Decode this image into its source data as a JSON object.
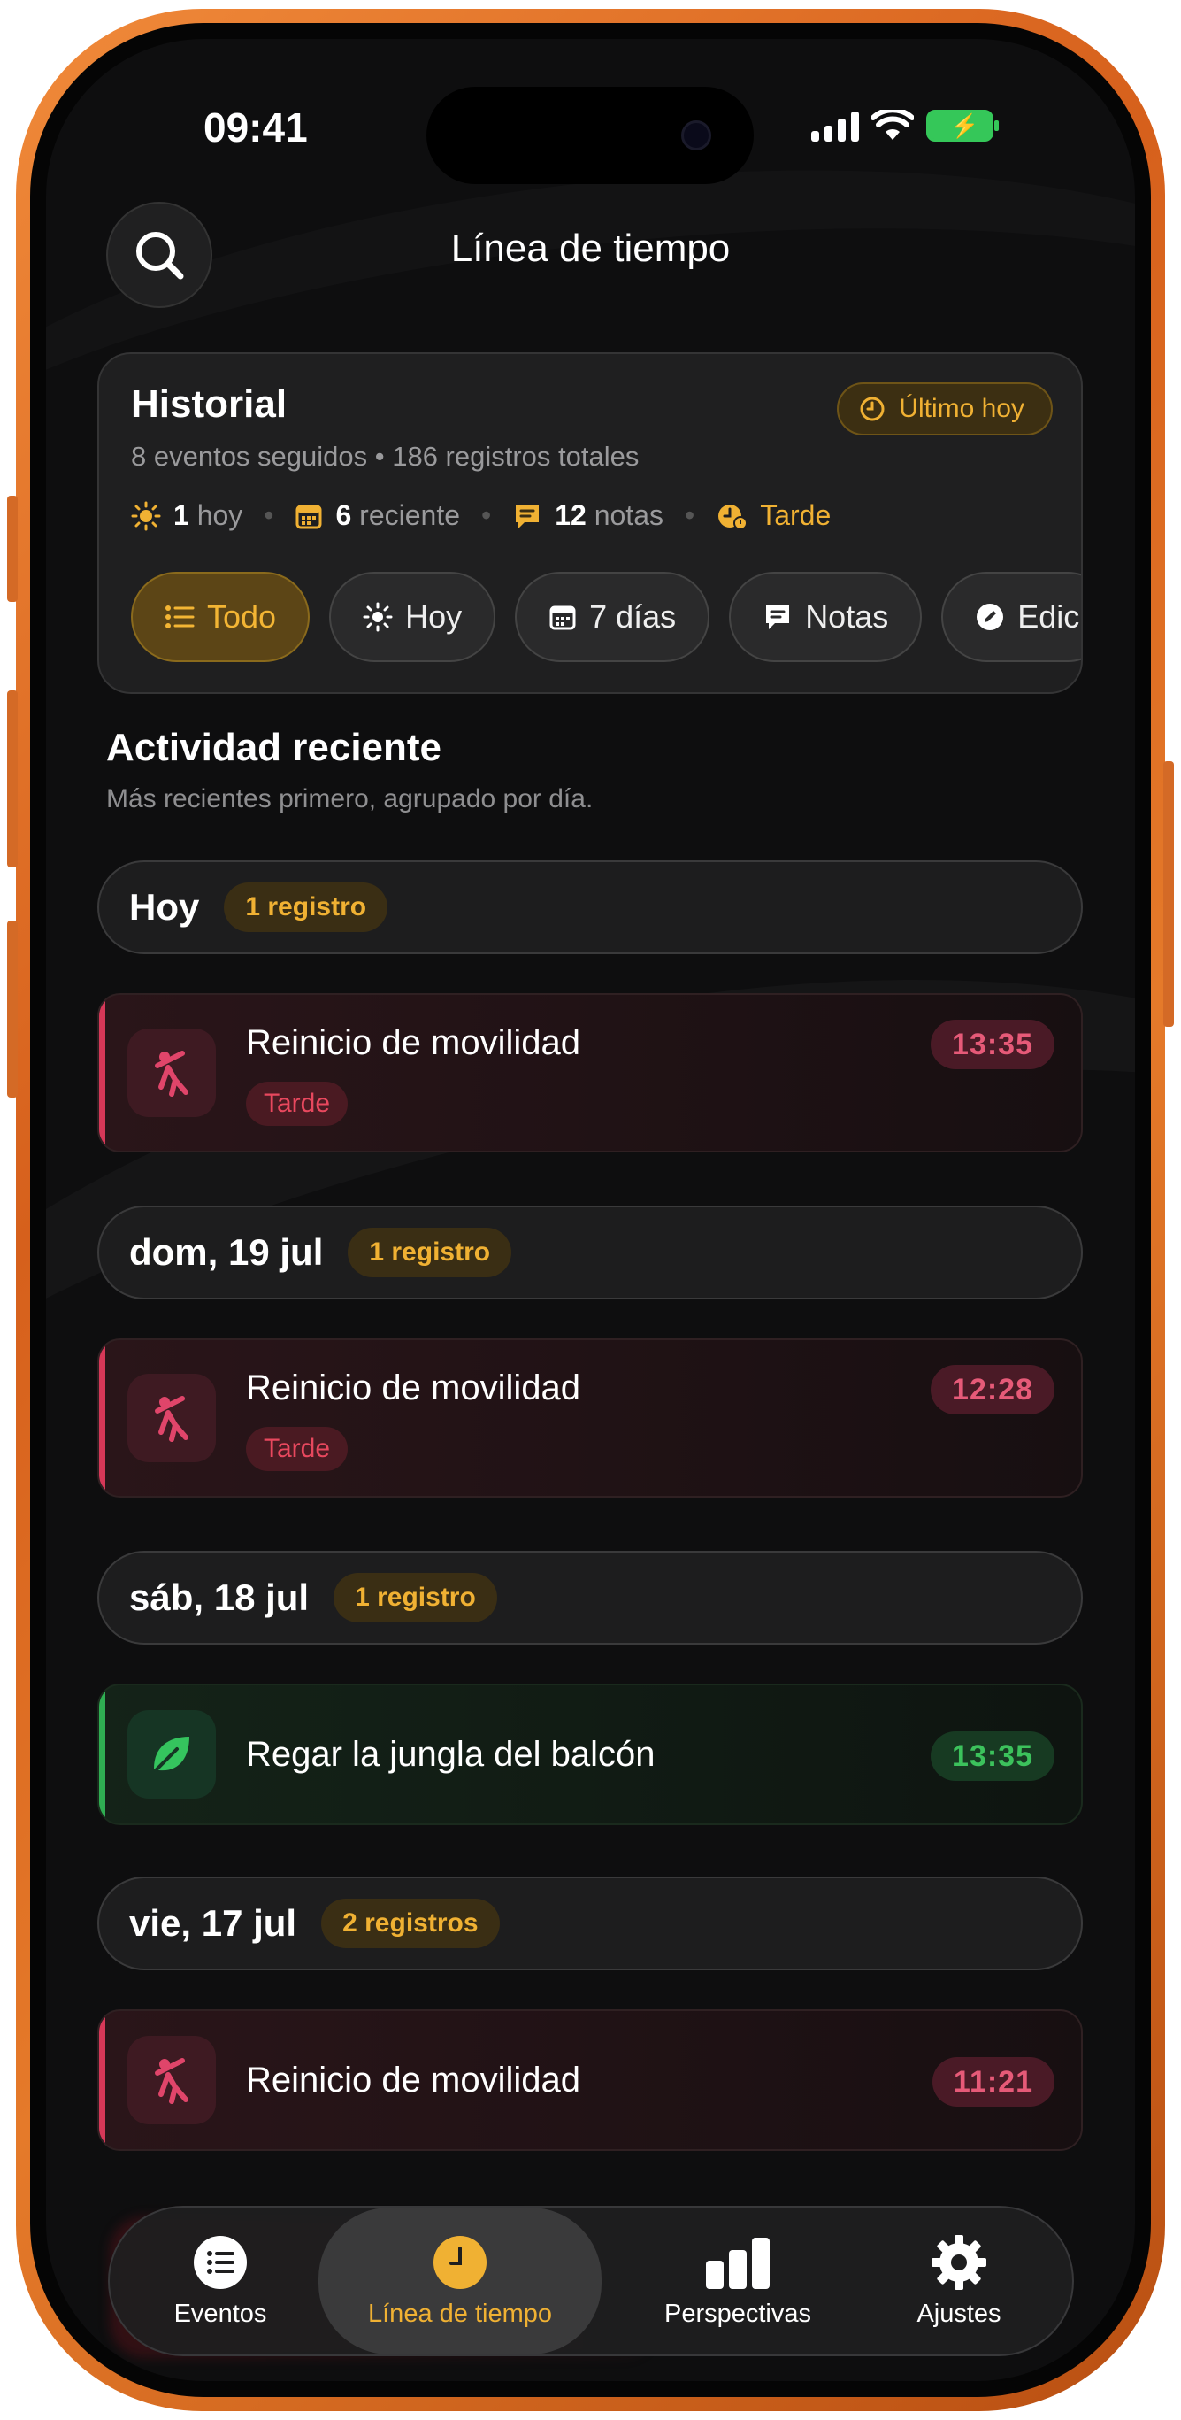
{
  "status_bar": {
    "time": "09:41"
  },
  "header": {
    "title": "Línea de tiempo"
  },
  "summary": {
    "title": "Historial",
    "subtitle": "8 eventos seguidos • 186 registros totales",
    "last_badge": "Último hoy",
    "stats": [
      {
        "icon": "sun-icon",
        "value": "1",
        "label": "hoy"
      },
      {
        "icon": "calendar-icon",
        "value": "6",
        "label": "reciente"
      },
      {
        "icon": "chat-icon",
        "value": "12",
        "label": "notas"
      },
      {
        "icon": "clock-alert-icon",
        "value": "",
        "label": "Tarde"
      }
    ],
    "filters": [
      {
        "icon": "list-icon",
        "label": "Todo",
        "active": true
      },
      {
        "icon": "sun-icon",
        "label": "Hoy"
      },
      {
        "icon": "calendar-icon",
        "label": "7 días"
      },
      {
        "icon": "chat-icon",
        "label": "Notas"
      },
      {
        "icon": "pencil-icon",
        "label": "Edic"
      }
    ]
  },
  "section": {
    "title": "Actividad reciente",
    "subtitle": "Más recientes primero, agrupado por día."
  },
  "days": [
    {
      "label": "Hoy",
      "count": "1 registro"
    },
    {
      "label": "dom, 19 jul",
      "count": "1 registro"
    },
    {
      "label": "sáb, 18 jul",
      "count": "1 registro"
    },
    {
      "label": "vie, 17 jul",
      "count": "2 registros"
    }
  ],
  "entries": [
    {
      "name": "Reinicio de movilidad",
      "tag": "Tarde",
      "time": "13:35",
      "icon": "stretch-figure-icon",
      "color": "#d63858"
    },
    {
      "name": "Reinicio de movilidad",
      "tag": "Tarde",
      "time": "12:28",
      "icon": "stretch-figure-icon",
      "color": "#d63858"
    },
    {
      "name": "Regar la jungla del balcón",
      "tag": "",
      "time": "13:35",
      "icon": "leaf-icon",
      "color": "#2fae52"
    },
    {
      "name": "Reinicio de movilidad",
      "tag": "",
      "time": "11:21",
      "icon": "stretch-figure-icon",
      "color": "#d63858"
    }
  ],
  "tabbar": {
    "tabs": [
      {
        "label": "Eventos",
        "icon": "list-icon"
      },
      {
        "label": "Línea de tiempo",
        "icon": "clock-icon",
        "active": true
      },
      {
        "label": "Perspectivas",
        "icon": "bar-chart-icon"
      },
      {
        "label": "Ajustes",
        "icon": "gear-icon"
      }
    ]
  }
}
